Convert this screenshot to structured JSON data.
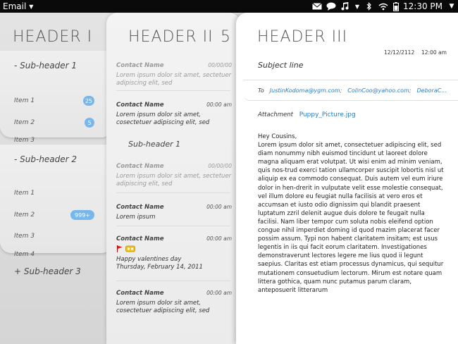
{
  "statusbar": {
    "app_menu": "Email",
    "time": "12:30 PM",
    "icons": [
      "mail-icon",
      "chat-icon",
      "music-icon",
      "bluetooth-icon",
      "wifi-icon",
      "battery-icon"
    ]
  },
  "pane1": {
    "header": "HEADER I",
    "groups": [
      {
        "label": "- Sub-header 1",
        "items": [
          {
            "label": "Item 1",
            "badge": "25"
          },
          {
            "label": "Item 2",
            "badge": "5"
          },
          {
            "label": "Item 3",
            "badge": ""
          }
        ]
      },
      {
        "label": "- Sub-header 2",
        "items": [
          {
            "label": "Item 1",
            "badge": ""
          },
          {
            "label": "Item 2",
            "badge": "999+"
          },
          {
            "label": "Item 3",
            "badge": ""
          },
          {
            "label": "Item 4",
            "badge": ""
          }
        ]
      }
    ],
    "collapsed_group": "+ Sub-header 3"
  },
  "pane2": {
    "header": "HEADER II",
    "count": "5",
    "messages": [
      {
        "from": "Contact Name",
        "time": "00/00/00",
        "body": "Lorem ipsum dolor sit amet, sectetuer adipiscing elit, sed"
      },
      {
        "from": "Contact Name",
        "time": "00:00 am",
        "body": "Lorem ipsum dolor sit amet, cosectetuer adipiscing elit, sed"
      }
    ],
    "subheader": "Sub-header 1",
    "messages2": [
      {
        "from": "Contact Name",
        "time": "00/00/00",
        "body": "Lorem ipsum dolor sit amet, sectetuer adipiscing elit, sed"
      },
      {
        "from": "Contact Name",
        "time": "00:00 am",
        "body": "Lorem ipsum"
      },
      {
        "from": "Contact Name",
        "time": "00:00 am",
        "body_line1": "Happy valentines day",
        "body_line2": "Thursday, February 14, 2011"
      },
      {
        "from": "Contact Name",
        "time": "00:00 am",
        "body": "Lorem ipsum dolor sit amet, cosectetuer adipiscing elit, sed"
      }
    ]
  },
  "pane3": {
    "header": "HEADER III",
    "date": "12/12/2112",
    "time": "12:00 am",
    "subject": "Subject line",
    "to_label": "To",
    "recipients": [
      "JustinKodoma@ygm.com;",
      "ColinCoo@yahoo.com;",
      "DeboraC..."
    ],
    "attachment_label": "Attachment",
    "attachment_name": "Puppy_Picture.jpg",
    "greeting": "Hey Cousins,",
    "body": "Lorem ipsum dolor sit amet, consectetuer adipiscing elit, sed diam nonummy nibh euismod tincidunt ut laoreet dolore magna aliquam erat volutpat. Ut wisi enim ad minim veniam, quis nos-trud exerci tation ullamcorper suscipit lobortis nisl ut aliquip ex ea commodo consequat. Duis autem vel eum iriure dolor in hen-drerit in vulputate velit esse molestie consequat, vel illum dolore eu feugiat nulla facilisis at vero eros et accumsan et iusto odio dignissim qui blandit praesent luptatum zzril delenit augue duis dolore te feugait nulla facilisi. Nam liber tempor cum soluta nobis eleifend option congue nihil imperdiet doming id quod mazim placerat facer possim assum. Typi non habent claritatem insitam; est usus legentis in iis qui facit eorum claritatem. Investigationes demonstraverunt lectores legere me lius quod ii legunt saepius. Claritas est etiam processus dynamicus, qui sequitur mutationem consuetudium lectorum. Mirum est notare quam littera gothica, quam nunc putamus parum claram, anteposuerit litterarum"
  }
}
